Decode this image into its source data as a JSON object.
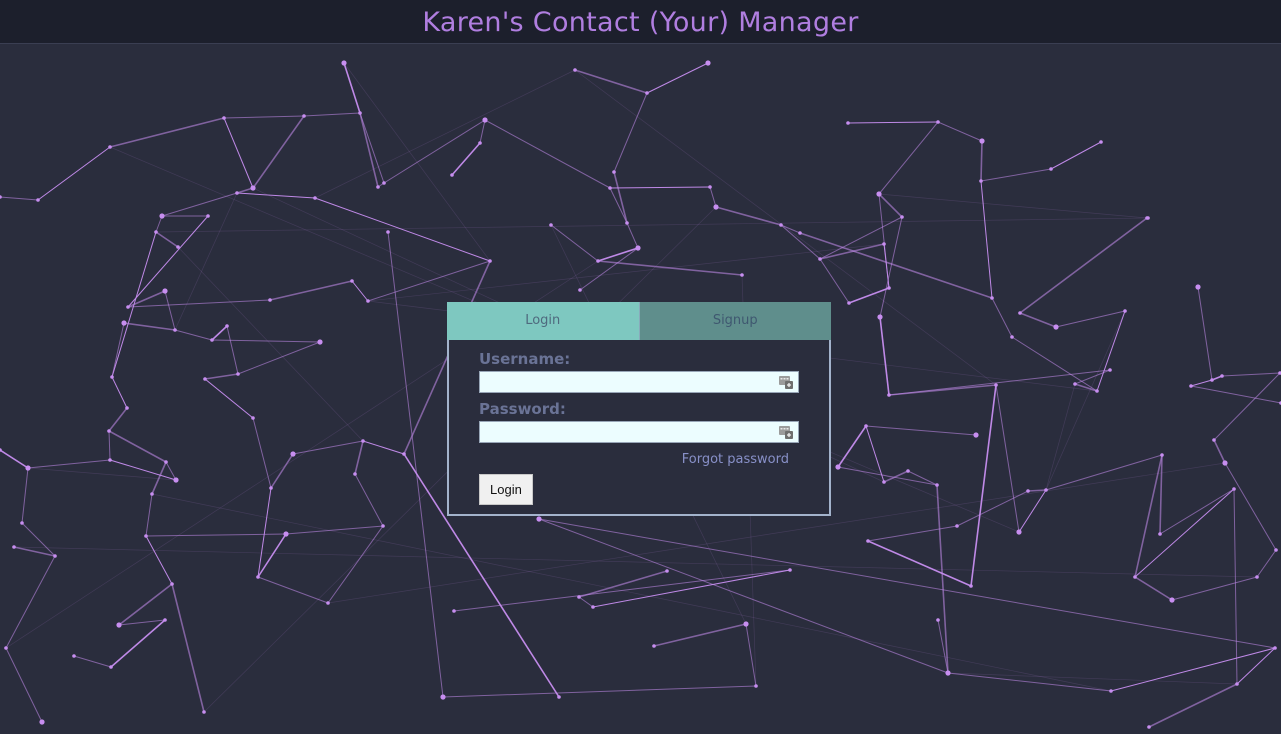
{
  "header": {
    "title": "Karen's Contact (Your) Manager"
  },
  "tabs": [
    {
      "label": "Login"
    },
    {
      "label": "Signup"
    }
  ],
  "form": {
    "username_label": "Username:",
    "username_value": "",
    "password_label": "Password:",
    "password_value": "",
    "forgot_label": "Forgot password",
    "login_button": "Login"
  },
  "colors": {
    "background": "#2a2d3d",
    "header": "#1c1f2c",
    "title": "#b07ee0",
    "network_line": "#c78ef0",
    "tab_active": "#7ec8c0",
    "tab_inactive": "#5f8e8c"
  },
  "icons": [
    "autofill-key-icon"
  ]
}
